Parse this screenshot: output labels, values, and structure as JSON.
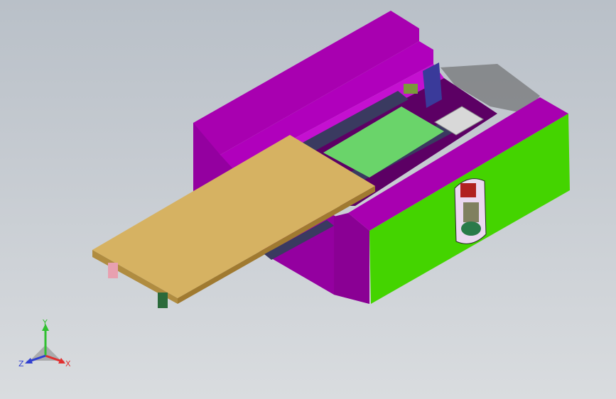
{
  "viewport": {
    "title": "",
    "background_top": "#b9c0c8",
    "background_bottom": "#d9dcdf"
  },
  "model": {
    "colors": {
      "frame": "#a800b0",
      "frame_dark": "#7c0084",
      "side_panel": "#44d400",
      "side_panel_top": "#a800b0",
      "platform": "#d6b262",
      "platform_edge": "#b08c40",
      "bed": "#6ad46a",
      "rail": "#3a3a60",
      "bracket": "#3a3a9a",
      "shadow": "#6f6f6f"
    }
  },
  "triad": {
    "x_label": "X",
    "y_label": "Y",
    "z_label": "Z",
    "x_color": "#e03030",
    "y_color": "#30c030",
    "z_color": "#3040d0"
  }
}
